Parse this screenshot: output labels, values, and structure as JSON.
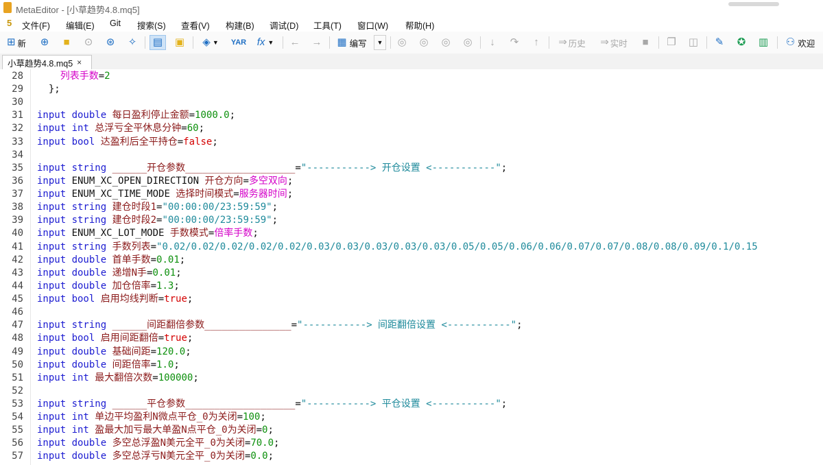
{
  "window": {
    "title": "MetaEditor - [小草趋势4.8.mq5]"
  },
  "menu": {
    "logo": "5",
    "items": [
      "文件(F)",
      "编辑(E)",
      "Git",
      "搜索(S)",
      "查看(V)",
      "构建(B)",
      "调试(D)",
      "工具(T)",
      "窗口(W)",
      "帮助(H)"
    ]
  },
  "toolbar": {
    "new_label": "新",
    "compile_label": "编写",
    "history_label": "历史",
    "realtime_label": "实时",
    "welcome_label": "欢迎"
  },
  "tab": {
    "label": "小草趋势4.8.mq5",
    "close": "×"
  },
  "code": {
    "lines": [
      {
        "n": "28",
        "t": [
          [
            "    ",
            "p"
          ],
          [
            "列表手数",
            "enm"
          ],
          [
            "=",
            "p"
          ],
          [
            "2",
            "num"
          ]
        ]
      },
      {
        "n": "29",
        "t": [
          [
            "  };",
            "p"
          ]
        ]
      },
      {
        "n": "30",
        "t": []
      },
      {
        "n": "31",
        "t": [
          [
            "input ",
            "kw"
          ],
          [
            "double ",
            "kw"
          ],
          [
            "每日盈利停止金额",
            "cn"
          ],
          [
            "=",
            "p"
          ],
          [
            "1000.0",
            "num"
          ],
          [
            ";",
            "p"
          ]
        ]
      },
      {
        "n": "32",
        "t": [
          [
            "input ",
            "kw"
          ],
          [
            "int ",
            "kw"
          ],
          [
            "总浮亏全平休息分钟",
            "cn"
          ],
          [
            "=",
            "p"
          ],
          [
            "60",
            "num"
          ],
          [
            ";",
            "p"
          ]
        ]
      },
      {
        "n": "33",
        "t": [
          [
            "input ",
            "kw"
          ],
          [
            "bool ",
            "kw"
          ],
          [
            "达盈利后全平持仓",
            "cn"
          ],
          [
            "=",
            "p"
          ],
          [
            "false",
            "bool"
          ],
          [
            ";",
            "p"
          ]
        ]
      },
      {
        "n": "34",
        "t": []
      },
      {
        "n": "35",
        "t": [
          [
            "input ",
            "kw"
          ],
          [
            "string ",
            "kw"
          ],
          [
            "______开仓参数___________________",
            "cn"
          ],
          [
            "=",
            "p"
          ],
          [
            "\"-----------> 开仓设置 <-----------\"",
            "str"
          ],
          [
            ";",
            "p"
          ]
        ]
      },
      {
        "n": "36",
        "t": [
          [
            "input ",
            "kw"
          ],
          [
            "ENUM_XC_OPEN_DIRECTION ",
            "id"
          ],
          [
            "开仓方向",
            "cn"
          ],
          [
            "=",
            "p"
          ],
          [
            "多空双向",
            "enm"
          ],
          [
            ";",
            "p"
          ]
        ]
      },
      {
        "n": "37",
        "t": [
          [
            "input ",
            "kw"
          ],
          [
            "ENUM_XC_TIME_MODE ",
            "id"
          ],
          [
            "选择时间模式",
            "cn"
          ],
          [
            "=",
            "p"
          ],
          [
            "服务器时间",
            "enm"
          ],
          [
            ";",
            "p"
          ]
        ]
      },
      {
        "n": "38",
        "t": [
          [
            "input ",
            "kw"
          ],
          [
            "string ",
            "kw"
          ],
          [
            "建仓时段1",
            "cn"
          ],
          [
            "=",
            "p"
          ],
          [
            "\"00:00:00/23:59:59\"",
            "str"
          ],
          [
            ";",
            "p"
          ]
        ]
      },
      {
        "n": "39",
        "t": [
          [
            "input ",
            "kw"
          ],
          [
            "string ",
            "kw"
          ],
          [
            "建仓时段2",
            "cn"
          ],
          [
            "=",
            "p"
          ],
          [
            "\"00:00:00/23:59:59\"",
            "str"
          ],
          [
            ";",
            "p"
          ]
        ]
      },
      {
        "n": "40",
        "t": [
          [
            "input ",
            "kw"
          ],
          [
            "ENUM_XC_LOT_MODE ",
            "id"
          ],
          [
            "手数模式",
            "cn"
          ],
          [
            "=",
            "p"
          ],
          [
            "倍率手数",
            "enm"
          ],
          [
            ";",
            "p"
          ]
        ]
      },
      {
        "n": "41",
        "t": [
          [
            "input ",
            "kw"
          ],
          [
            "string ",
            "kw"
          ],
          [
            "手数列表",
            "cn"
          ],
          [
            "=",
            "p"
          ],
          [
            "\"0.02/0.02/0.02/0.02/0.02/0.03/0.03/0.03/0.03/0.03/0.05/0.05/0.06/0.06/0.07/0.07/0.08/0.08/0.09/0.1/0.15",
            "str"
          ]
        ]
      },
      {
        "n": "42",
        "t": [
          [
            "input ",
            "kw"
          ],
          [
            "double ",
            "kw"
          ],
          [
            "首单手数",
            "cn"
          ],
          [
            "=",
            "p"
          ],
          [
            "0.01",
            "num"
          ],
          [
            ";",
            "p"
          ]
        ]
      },
      {
        "n": "43",
        "t": [
          [
            "input ",
            "kw"
          ],
          [
            "double ",
            "kw"
          ],
          [
            "递增N手",
            "cn"
          ],
          [
            "=",
            "p"
          ],
          [
            "0.01",
            "num"
          ],
          [
            ";",
            "p"
          ]
        ]
      },
      {
        "n": "44",
        "t": [
          [
            "input ",
            "kw"
          ],
          [
            "double ",
            "kw"
          ],
          [
            "加仓倍率",
            "cn"
          ],
          [
            "=",
            "p"
          ],
          [
            "1.3",
            "num"
          ],
          [
            ";",
            "p"
          ]
        ]
      },
      {
        "n": "45",
        "t": [
          [
            "input ",
            "kw"
          ],
          [
            "bool ",
            "kw"
          ],
          [
            "启用均线判断",
            "cn"
          ],
          [
            "=",
            "p"
          ],
          [
            "true",
            "bool"
          ],
          [
            ";",
            "p"
          ]
        ]
      },
      {
        "n": "46",
        "t": []
      },
      {
        "n": "47",
        "t": [
          [
            "input ",
            "kw"
          ],
          [
            "string ",
            "kw"
          ],
          [
            "______间距翻倍参数_______________",
            "cn"
          ],
          [
            "=",
            "p"
          ],
          [
            "\"-----------> 间距翻倍设置 <-----------\"",
            "str"
          ],
          [
            ";",
            "p"
          ]
        ]
      },
      {
        "n": "48",
        "t": [
          [
            "input ",
            "kw"
          ],
          [
            "bool ",
            "kw"
          ],
          [
            "启用间距翻倍",
            "cn"
          ],
          [
            "=",
            "p"
          ],
          [
            "true",
            "bool"
          ],
          [
            ";",
            "p"
          ]
        ]
      },
      {
        "n": "49",
        "t": [
          [
            "input ",
            "kw"
          ],
          [
            "double ",
            "kw"
          ],
          [
            "基础间距",
            "cn"
          ],
          [
            "=",
            "p"
          ],
          [
            "120.0",
            "num"
          ],
          [
            ";",
            "p"
          ]
        ]
      },
      {
        "n": "50",
        "t": [
          [
            "input ",
            "kw"
          ],
          [
            "double ",
            "kw"
          ],
          [
            "间距倍率",
            "cn"
          ],
          [
            "=",
            "p"
          ],
          [
            "1.0",
            "num"
          ],
          [
            ";",
            "p"
          ]
        ]
      },
      {
        "n": "51",
        "t": [
          [
            "input ",
            "kw"
          ],
          [
            "int ",
            "kw"
          ],
          [
            "最大翻倍次数",
            "cn"
          ],
          [
            "=",
            "p"
          ],
          [
            "100000",
            "num"
          ],
          [
            ";",
            "p"
          ]
        ]
      },
      {
        "n": "52",
        "t": []
      },
      {
        "n": "53",
        "t": [
          [
            "input ",
            "kw"
          ],
          [
            "string ",
            "kw"
          ],
          [
            "______平仓参数___________________",
            "cn"
          ],
          [
            "=",
            "p"
          ],
          [
            "\"-----------> 平仓设置 <-----------\"",
            "str"
          ],
          [
            ";",
            "p"
          ]
        ]
      },
      {
        "n": "54",
        "t": [
          [
            "input ",
            "kw"
          ],
          [
            "int ",
            "kw"
          ],
          [
            "单边平均盈利N微点平仓_0为关闭",
            "cn"
          ],
          [
            "=",
            "p"
          ],
          [
            "100",
            "num"
          ],
          [
            ";",
            "p"
          ]
        ]
      },
      {
        "n": "55",
        "t": [
          [
            "input ",
            "kw"
          ],
          [
            "int ",
            "kw"
          ],
          [
            "盈最大加亏最大单盈N点平仓_0为关闭",
            "cn"
          ],
          [
            "=",
            "p"
          ],
          [
            "0",
            "num"
          ],
          [
            ";",
            "p"
          ]
        ]
      },
      {
        "n": "56",
        "t": [
          [
            "input ",
            "kw"
          ],
          [
            "double ",
            "kw"
          ],
          [
            "多空总浮盈N美元全平_0为关闭",
            "cn"
          ],
          [
            "=",
            "p"
          ],
          [
            "70.0",
            "num"
          ],
          [
            ";",
            "p"
          ]
        ]
      },
      {
        "n": "57",
        "t": [
          [
            "input ",
            "kw"
          ],
          [
            "double ",
            "kw"
          ],
          [
            "多空总浮亏N美元全平_0为关闭",
            "cn"
          ],
          [
            "=",
            "p"
          ],
          [
            "0.0",
            "num"
          ],
          [
            ";",
            "p"
          ]
        ]
      }
    ]
  }
}
